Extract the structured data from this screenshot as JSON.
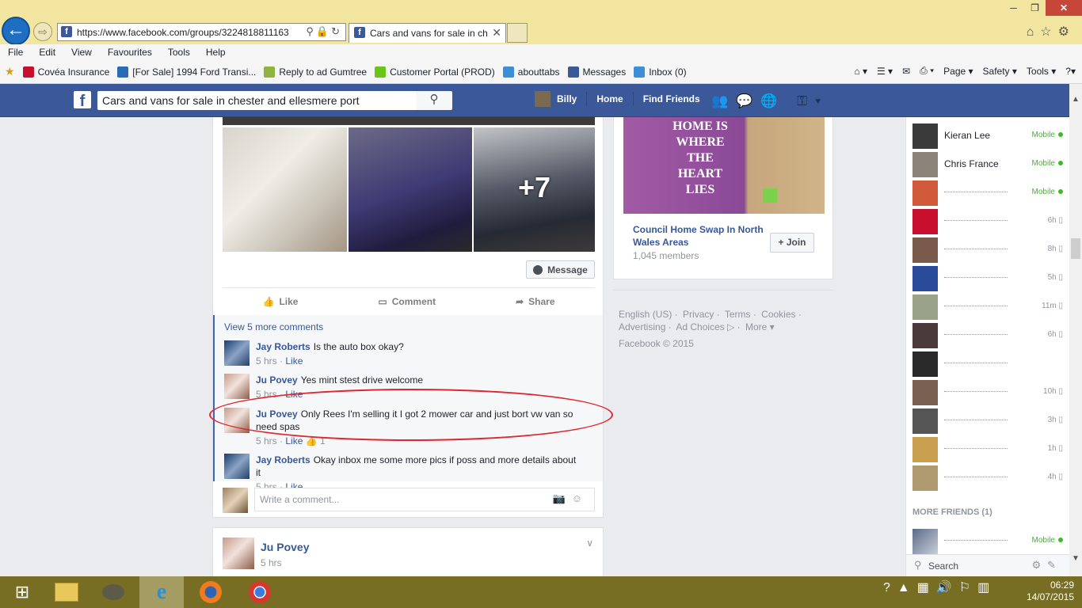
{
  "browser": {
    "url": "https://www.facebook.com/groups/3224818811163",
    "tab_title": "Cars and vans for sale in ch...",
    "menu": [
      "File",
      "Edit",
      "View",
      "Favourites",
      "Tools",
      "Help"
    ],
    "favourites": [
      {
        "label": "Covéa Insurance",
        "color": "#c8102e"
      },
      {
        "label": "[For Sale] 1994 Ford Transi...",
        "color": "#2a6bb8"
      },
      {
        "label": "Reply to ad  Gumtree",
        "color": "#8db43c"
      },
      {
        "label": "Customer Portal (PROD)",
        "color": "#6cc418"
      },
      {
        "label": "abouttabs",
        "color": "#3c8fd6"
      },
      {
        "label": "Messages",
        "color": "#3b5998"
      },
      {
        "label": "Inbox (0)",
        "color": "#3c8fd6"
      }
    ],
    "commands": [
      "Page ▾",
      "Safety ▾",
      "Tools ▾"
    ]
  },
  "header": {
    "search_value": "Cars and vans for sale in chester and ellesmere port",
    "user_name": "Billy",
    "home": "Home",
    "find_friends": "Find Friends"
  },
  "post": {
    "more_photos": "+7",
    "message_button": "Message",
    "actions": {
      "like": "Like",
      "comment": "Comment",
      "share": "Share"
    },
    "view_more": "View 5 more comments",
    "comments": [
      {
        "author": "Jay Roberts",
        "text": "Is the auto box okay?",
        "time": "5 hrs",
        "like": "Like",
        "likes": ""
      },
      {
        "author": "Ju Povey",
        "text": "Yes mint stest drive welcome",
        "time": "5 hrs",
        "like": "Like",
        "likes": ""
      },
      {
        "author": "Ju Povey",
        "text": "Only Rees I'm selling it I got 2 mower car and just bort vw van so need spas",
        "time": "5 hrs",
        "like": "Like",
        "likes": "1"
      },
      {
        "author": "Jay Roberts",
        "text": "Okay inbox me some more pics if poss and more details about it",
        "time": "5 hrs",
        "like": "Like",
        "likes": ""
      }
    ],
    "write_placeholder": "Write a comment..."
  },
  "next_post": {
    "author": "Ju Povey",
    "time": "5 hrs"
  },
  "group_card": {
    "image_text": "HOME IS WHERE THE HEART LIES",
    "name": "Council Home Swap In North Wales Areas",
    "members": "1,045 members",
    "join": "+ Join"
  },
  "footer": {
    "links": [
      "English (US) ·",
      "Privacy ·",
      "Terms ·",
      "Cookies ·",
      "Advertising ·",
      "Ad Choices ▷ ·",
      "More ▾"
    ],
    "copyright": "Facebook © 2015"
  },
  "chat": {
    "contacts": [
      {
        "name": "Kieran Lee",
        "status": "Mobile"
      },
      {
        "name": "Chris France",
        "status": "Mobile"
      },
      {
        "name": "",
        "status": "Mobile"
      },
      {
        "name": "",
        "status": "6h"
      },
      {
        "name": "",
        "status": "8h"
      },
      {
        "name": "",
        "status": "5h"
      },
      {
        "name": "",
        "status": "11m"
      },
      {
        "name": "",
        "status": "6h"
      },
      {
        "name": "",
        "status": ""
      },
      {
        "name": "",
        "status": "10h"
      },
      {
        "name": "",
        "status": "3h"
      },
      {
        "name": "",
        "status": "1h"
      },
      {
        "name": "",
        "status": "4h"
      }
    ],
    "more_friends": "MORE FRIENDS (1)",
    "extra_status": "Mobile",
    "search": "Search"
  },
  "taskbar": {
    "time": "06:29",
    "date": "14/07/2015"
  }
}
